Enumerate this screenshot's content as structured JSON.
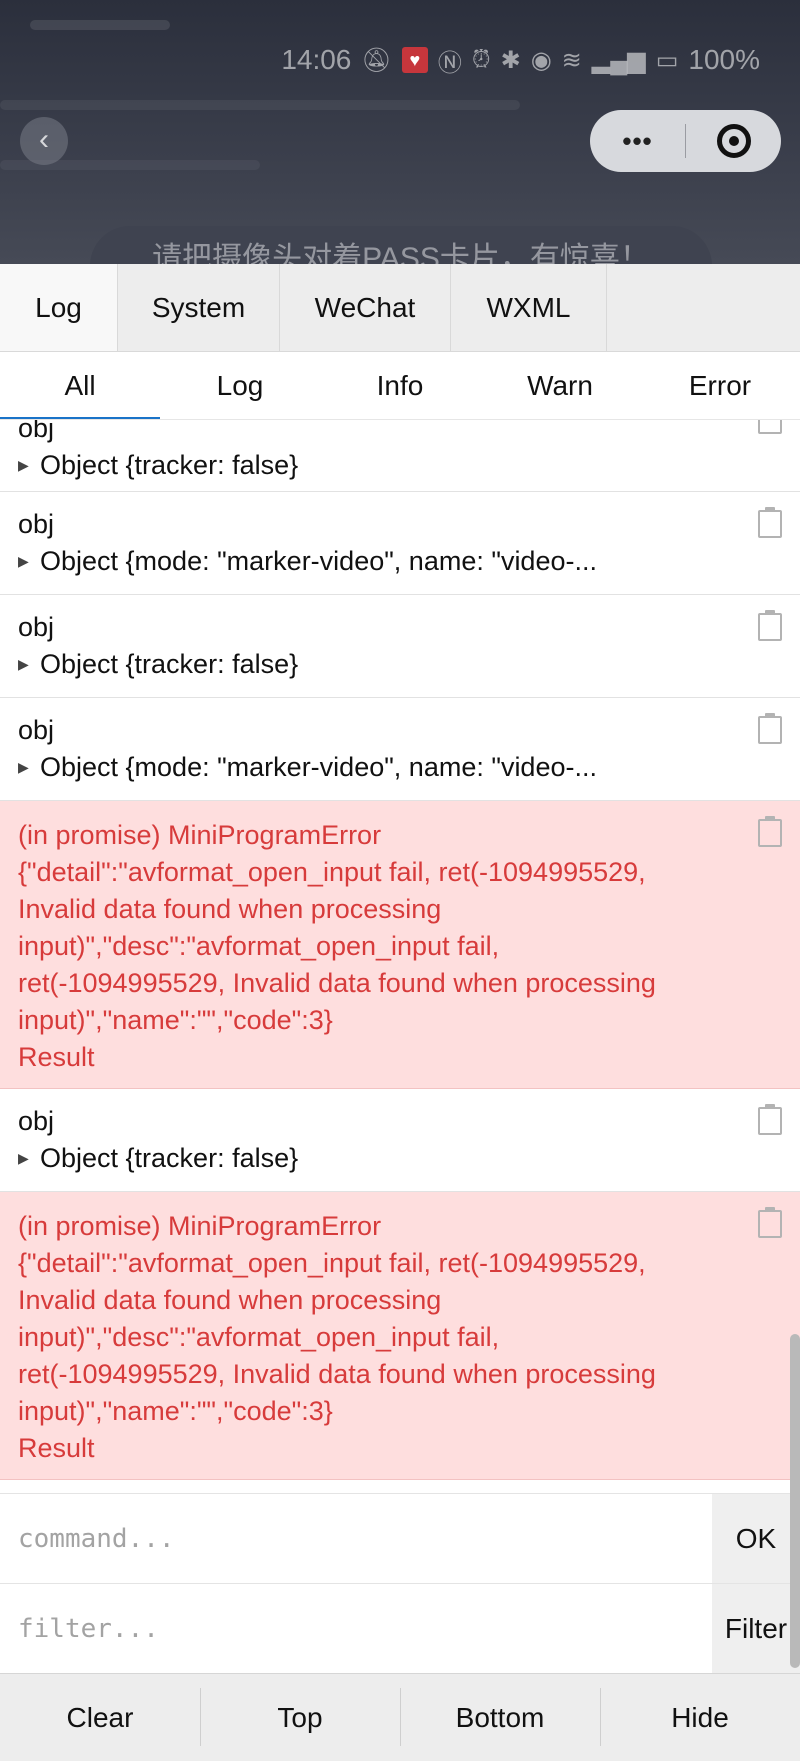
{
  "status_bar": {
    "time": "14:06",
    "battery": "100%",
    "icons": [
      "mute-icon",
      "app-heart-icon",
      "nfc-icon",
      "alarm-icon",
      "bluetooth-icon",
      "camera-icon",
      "wifi-icon",
      "signal-5g-icon",
      "battery-icon"
    ]
  },
  "nav": {
    "back_icon": "chevron-left-icon",
    "capsule_more": "•••",
    "capsule_close_icon": "target-icon"
  },
  "banner_text": "请把摄像头对着PASS卡片，有惊喜！",
  "tabs": [
    {
      "label": "Log",
      "active": true
    },
    {
      "label": "System",
      "active": false
    },
    {
      "label": "WeChat",
      "active": false
    },
    {
      "label": "WXML",
      "active": false
    }
  ],
  "subtabs": [
    {
      "label": "All",
      "active": true
    },
    {
      "label": "Log",
      "active": false
    },
    {
      "label": "Info",
      "active": false
    },
    {
      "label": "Warn",
      "active": false
    },
    {
      "label": "Error",
      "active": false
    }
  ],
  "logs": [
    {
      "type": "obj",
      "label": "obj",
      "summary": "Object {tracker: false}"
    },
    {
      "type": "obj",
      "label": "obj",
      "summary": "Object {mode: \"marker-video\", name: \"video-..."
    },
    {
      "type": "obj",
      "label": "obj",
      "summary": "Object {tracker: false}"
    },
    {
      "type": "obj",
      "label": "obj",
      "summary": "Object {mode: \"marker-video\", name: \"video-..."
    },
    {
      "type": "error",
      "message": "(in promise) MiniProgramError\n{\"detail\":\"avformat_open_input fail, ret(-1094995529,\nInvalid data found when processing\ninput)\",\"desc\":\"avformat_open_input fail,\nret(-1094995529, Invalid data found when processing\ninput)\",\"name\":\"\",\"code\":3}\nResult"
    },
    {
      "type": "obj",
      "label": "obj",
      "summary": "Object {tracker: false}"
    },
    {
      "type": "error",
      "message": "(in promise) MiniProgramError\n{\"detail\":\"avformat_open_input fail, ret(-1094995529,\nInvalid data found when processing\ninput)\",\"desc\":\"avformat_open_input fail,\nret(-1094995529, Invalid data found when processing\ninput)\",\"name\":\"\",\"code\":3}\nResult"
    }
  ],
  "command": {
    "placeholder": "command...",
    "value": "",
    "button": "OK"
  },
  "filter": {
    "placeholder": "filter...",
    "value": "",
    "button": "Filter"
  },
  "footer": {
    "clear": "Clear",
    "top": "Top",
    "bottom": "Bottom",
    "hide": "Hide"
  },
  "colors": {
    "error_bg": "#fedede",
    "error_text": "#d73b3b",
    "active_tab_underline": "#1a73c8"
  }
}
